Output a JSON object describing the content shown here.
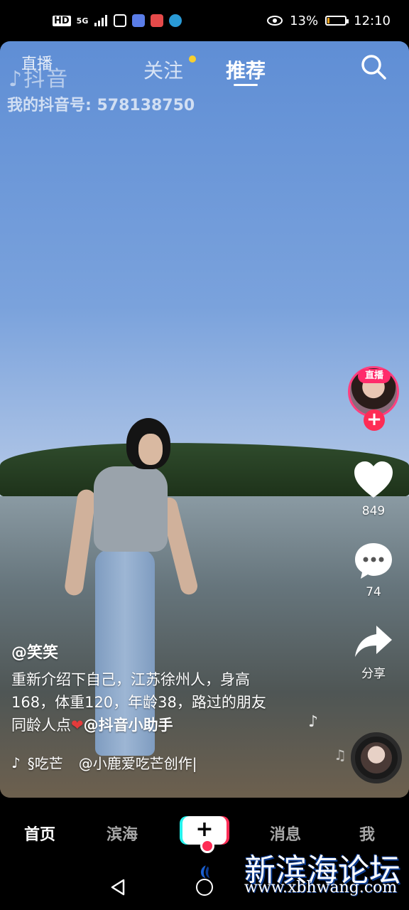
{
  "status_bar": {
    "network": "HD",
    "signal": "5G",
    "battery_percent": "13%",
    "battery_level": 0.13,
    "time": "12:10"
  },
  "top_nav": {
    "watermark_logo": "抖音",
    "live_label": "直播",
    "tab_follow": "关注",
    "tab_recommend": "推荐",
    "account_id_label": "我的抖音号: 578138750"
  },
  "side_actions": {
    "live_badge": "直播",
    "likes": "849",
    "comments": "74",
    "share_label": "分享"
  },
  "post": {
    "author": "@笑笑",
    "caption_line1": "重新介绍下自己，江苏徐州人，身高",
    "caption_line2": "168，体重120，年龄38，路过的朋友",
    "caption_line3_prefix": "同龄人点",
    "mention": "@抖音小助手",
    "music_left": "§吃芒",
    "music_right": "@小鹿爱吃芒创作|"
  },
  "tab_bar": {
    "home": "首页",
    "local": "滨海",
    "messages": "消息",
    "me": "我"
  },
  "watermark": {
    "name": "新滨海论坛",
    "url": "www.xbhwang.com"
  },
  "colors": {
    "accent_red": "#fe2c55",
    "accent_cyan": "#25f4ee",
    "follow_dot": "#f7cf2e"
  }
}
